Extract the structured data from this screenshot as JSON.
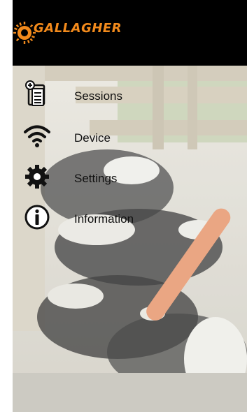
{
  "header": {
    "brand": "GALLAGHER",
    "brand_color": "#f28a1c",
    "background": "#000000"
  },
  "menu": {
    "items": [
      {
        "label": "Sessions",
        "icon": "sessions-clipboard-icon"
      },
      {
        "label": "Device",
        "icon": "wifi-icon"
      },
      {
        "label": "Settings",
        "icon": "gear-icon"
      },
      {
        "label": "Information",
        "icon": "info-icon"
      }
    ]
  },
  "background": {
    "description_icon": "cattle-in-pen-photo"
  }
}
